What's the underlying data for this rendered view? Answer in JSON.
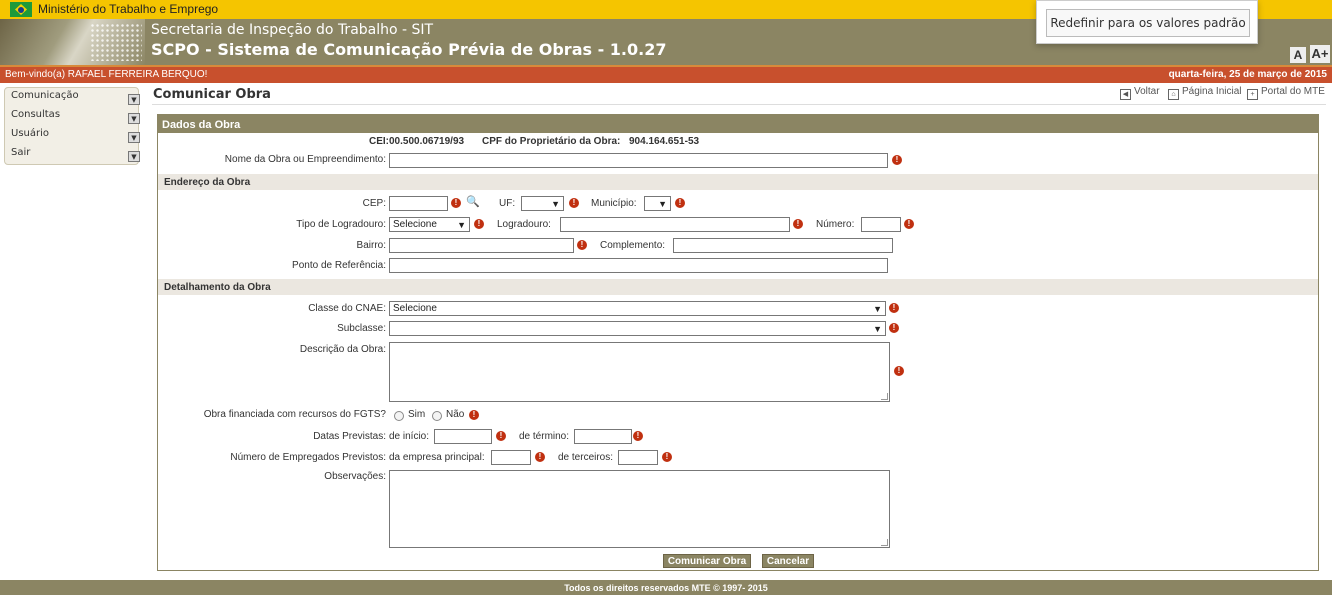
{
  "gov_bar": {
    "title": "Ministério do Trabalho e Emprego"
  },
  "header": {
    "subtitle": "Secretaria de Inspeção do Trabalho - SIT",
    "title": "SCPO - Sistema de Comunicação Prévia de Obras - 1.0.27",
    "font_small": "A",
    "font_large": "A+"
  },
  "popup": {
    "button": "Redefinir para os valores padrão"
  },
  "welcome": {
    "user": "Bem-vindo(a) RAFAEL FERREIRA BERQUO!",
    "date": "quarta-feira, 25 de março de 2015"
  },
  "sidebar": {
    "items": [
      {
        "label": "Comunicação"
      },
      {
        "label": "Consultas"
      },
      {
        "label": "Usuário"
      },
      {
        "label": "Sair"
      }
    ]
  },
  "page": {
    "title": "Comunicar Obra",
    "links": {
      "back": "Voltar",
      "home": "Página Inicial",
      "portal": "Portal do MTE"
    }
  },
  "form": {
    "panel_title": "Dados da Obra",
    "cei": "CEI:00.500.06719/93",
    "cpf_label": "CPF do Proprietário da Obra:",
    "cpf_value": "904.164.651-53",
    "nome_label": "Nome da Obra ou Empreendimento:",
    "endereco_section": "Endereço da Obra",
    "cep_label": "CEP:",
    "uf_label": "UF:",
    "municipio_label": "Município:",
    "tipo_logradouro_label": "Tipo de Logradouro:",
    "tipo_logradouro_value": "Selecione",
    "logradouro_label": "Logradouro:",
    "numero_label": "Número:",
    "bairro_label": "Bairro:",
    "complemento_label": "Complemento:",
    "ponto_label": "Ponto de Referência:",
    "detalhamento_section": "Detalhamento da Obra",
    "cnae_label": "Classe do CNAE:",
    "cnae_value": "Selecione",
    "subclasse_label": "Subclasse:",
    "descricao_label": "Descrição da Obra:",
    "fgts_label": "Obra financiada com recursos do FGTS?",
    "fgts_sim": "Sim",
    "fgts_nao": "Não",
    "datas_label": "Datas Previstas:",
    "inicio_label": "de início:",
    "termino_label": "de término:",
    "empregados_label": "Número de Empregados Previstos:",
    "empresa_label": "da empresa principal:",
    "terceiros_label": "de terceiros:",
    "observacoes_label": "Observações:",
    "submit": "Comunicar Obra",
    "cancel": "Cancelar"
  },
  "footer": {
    "text": "Todos os direitos reservados MTE © 1997- 2015"
  },
  "colors": {
    "gov_yellow": "#f5c500",
    "header_olive": "#8b8563",
    "welcome_red": "#c8502d",
    "required_red": "#c03010"
  }
}
